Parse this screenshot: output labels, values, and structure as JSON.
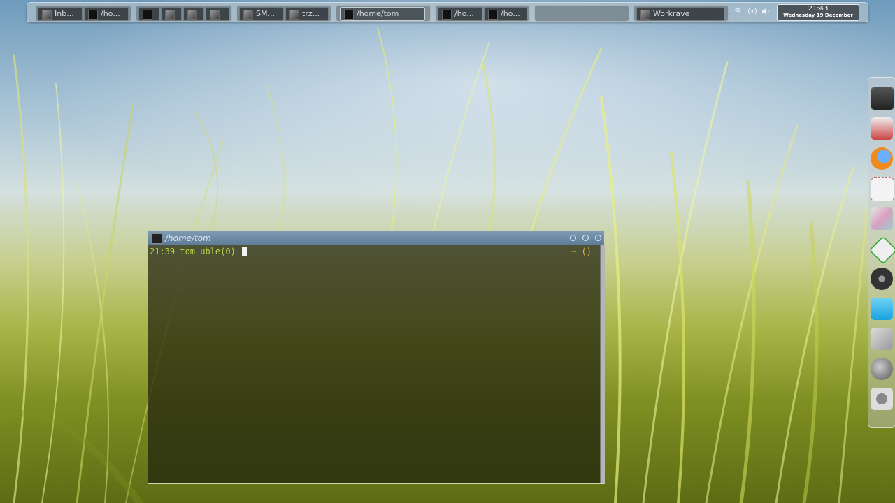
{
  "taskbar": {
    "groups": [
      {
        "tasks": [
          {
            "label": "Inb...",
            "icon": "mail-icon"
          },
          {
            "label": "/ho...",
            "icon": "terminal-icon"
          }
        ]
      },
      {
        "tasks": [
          {
            "label": "",
            "icon": "terminal-icon"
          },
          {
            "label": "",
            "icon": "gimp-icon"
          },
          {
            "label": "",
            "icon": "wilber-icon"
          },
          {
            "label": "",
            "icon": "wilber-icon"
          }
        ]
      },
      {
        "tasks": [
          {
            "label": "SM...",
            "icon": "smplayer-icon"
          },
          {
            "label": "trz...",
            "icon": "transcoder-icon"
          }
        ]
      },
      {
        "tasks": [
          {
            "label": "/home/tom",
            "icon": "terminal-icon",
            "active": true
          }
        ]
      },
      {
        "tasks": [
          {
            "label": "/ho...",
            "icon": "terminal-icon"
          },
          {
            "label": "/ho...",
            "icon": "terminal-icon"
          }
        ]
      },
      {
        "tasks": []
      },
      {
        "tasks": [
          {
            "label": "Workrave",
            "icon": "sheep-icon"
          }
        ]
      }
    ],
    "tray_icons": [
      "wifi-icon",
      "network-icon",
      "volume-icon"
    ],
    "clock": {
      "time": "21:43",
      "date": "Wednesday 19 December"
    }
  },
  "terminal": {
    "title": "/home/tom",
    "prompt": "21:39 tom uble(0)",
    "right_prompt": "~ ()",
    "colors": {
      "prompt": "#b7d648",
      "right_prompt": "#e0b84a",
      "titlebar": "#6a88a4"
    }
  },
  "dock": {
    "items": [
      "terminal-icon",
      "network-manager-icon",
      "firefox-icon",
      "text-editor-icon",
      "image-viewer-icon",
      "vim-icon",
      "media-player-icon",
      "skype-icon",
      "drawing-icon",
      "web-browser-icon",
      "camera-icon"
    ]
  }
}
